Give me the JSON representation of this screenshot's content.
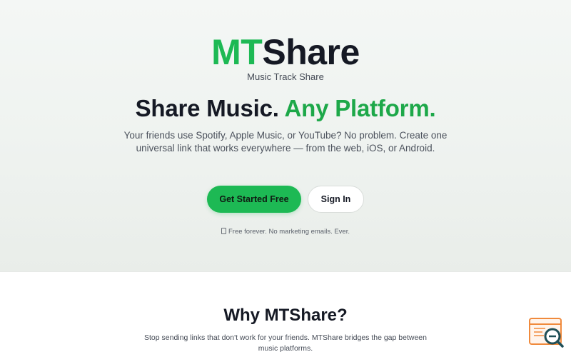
{
  "hero": {
    "logo": {
      "part1": "MT",
      "part2": "Share"
    },
    "tagline": "Music Track Share",
    "headline": {
      "plain": "Share Music.",
      "accent": "Any Platform."
    },
    "description": "Your friends use Spotify, Apple Music, or YouTube? No problem. Create one universal link that works everywhere — from the web, iOS, or Android.",
    "buttons": {
      "primary_label": "Get Started Free",
      "secondary_label": "Sign In"
    },
    "note": "Free forever. No marketing emails. Ever."
  },
  "why": {
    "title": "Why MTShare?",
    "description": "Stop sending links that don't work for your friends. MTShare bridges the gap between music platforms."
  },
  "colors": {
    "brand_green": "#1db954",
    "accent_green": "#1da849",
    "text_dark": "#151924",
    "badge_orange": "#f08a3c",
    "badge_teal": "#1f4f57"
  },
  "icons": {
    "note_icon": "gift-icon",
    "floating_badge": "search-icon"
  }
}
